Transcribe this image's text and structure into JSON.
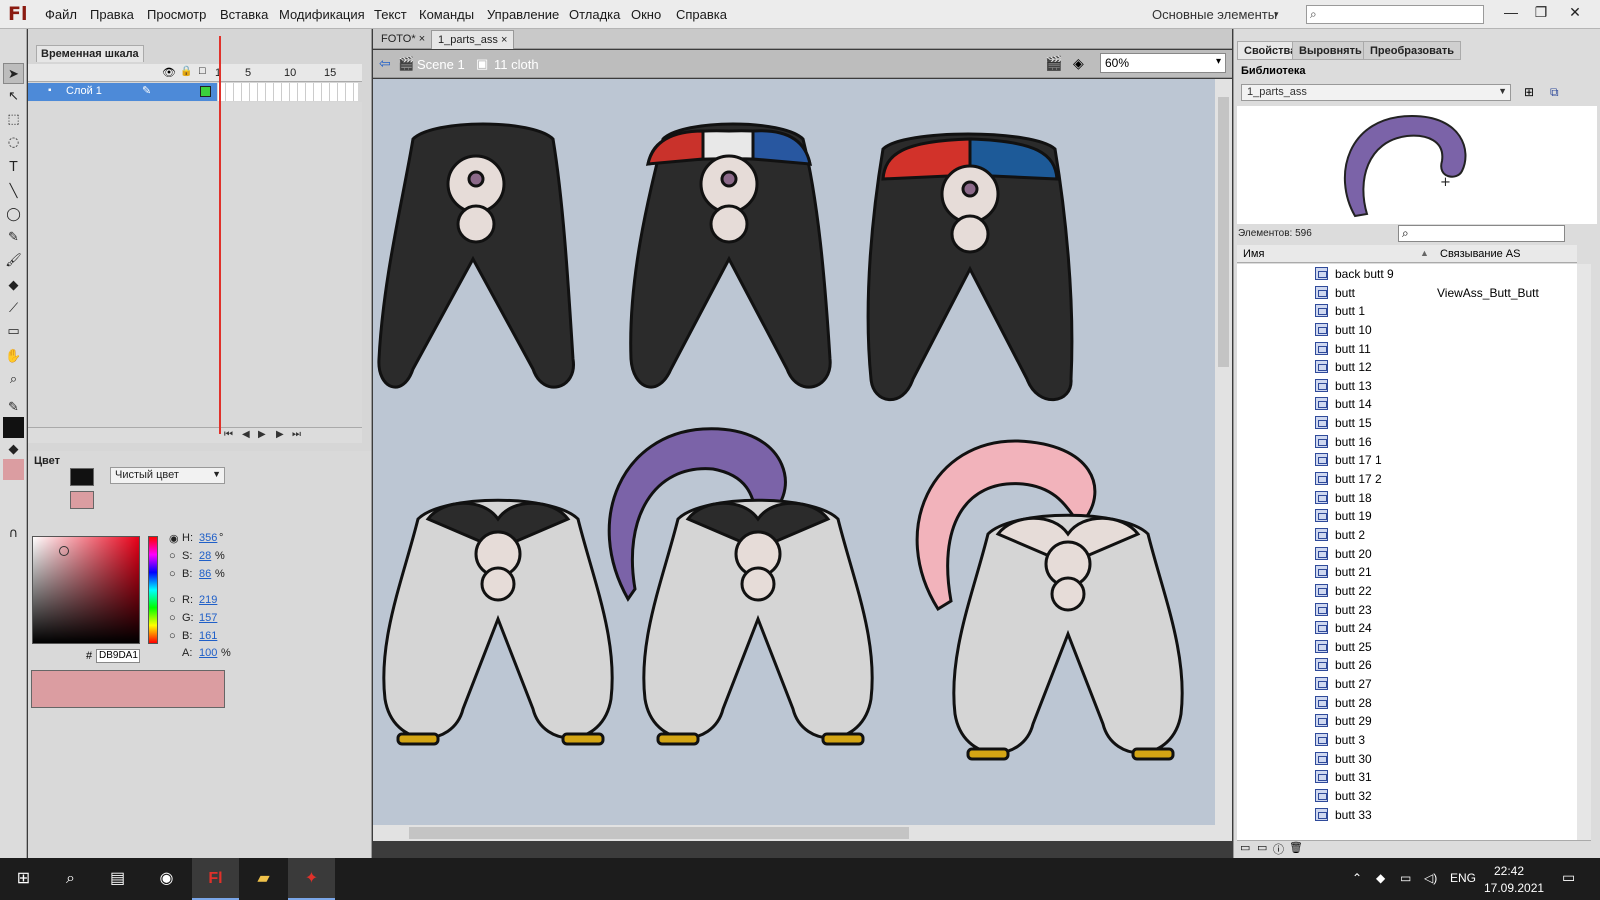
{
  "app": {
    "logo": "Fl",
    "menu": [
      "Файл",
      "Правка",
      "Просмотр",
      "Вставка",
      "Модификация",
      "Текст",
      "Команды",
      "Управление",
      "Отладка",
      "Окно",
      "Справка"
    ],
    "workspace": "Основные элементы"
  },
  "timeline": {
    "title": "Временная шкала",
    "layer_name": "Слой 1",
    "ruler": [
      "1",
      "5",
      "10",
      "15"
    ]
  },
  "color": {
    "title": "Цвет",
    "fill_type": "Чистый цвет",
    "h_label": "H:",
    "h": "356",
    "h_unit": "°",
    "s_label": "S:",
    "s": "28",
    "s_unit": "%",
    "b_label": "B:",
    "b": "86",
    "b_unit": "%",
    "r_label": "R:",
    "r": "219",
    "g_label": "G:",
    "g": "157",
    "bl_label": "B:",
    "bl": "161",
    "a_label": "A:",
    "a": "100",
    "a_unit": "%",
    "hex_symbol": "#",
    "hex": "DB9DA1",
    "color_value": "#db9da1"
  },
  "document": {
    "tabs": [
      "FOTO*",
      "1_parts_ass"
    ],
    "close_glyph": "×",
    "scene": "Scene 1",
    "symbol": "11 cloth",
    "zoom": "60%"
  },
  "right_panel": {
    "tabs": [
      "Свойства",
      "Выровнять",
      "Преобразовать"
    ],
    "library_title": "Библиотека",
    "library_file": "1_parts_ass",
    "item_count": "Элементов: 596",
    "col_name": "Имя",
    "col_link": "Связывание AS",
    "items": [
      {
        "name": "back butt 9",
        "link": ""
      },
      {
        "name": "butt",
        "link": "ViewAss_Butt_Butt"
      },
      {
        "name": "butt 1",
        "link": ""
      },
      {
        "name": "butt 10",
        "link": ""
      },
      {
        "name": "butt 11",
        "link": ""
      },
      {
        "name": "butt 12",
        "link": ""
      },
      {
        "name": "butt 13",
        "link": ""
      },
      {
        "name": "butt 14",
        "link": ""
      },
      {
        "name": "butt 15",
        "link": ""
      },
      {
        "name": "butt 16",
        "link": ""
      },
      {
        "name": "butt 17 1",
        "link": ""
      },
      {
        "name": "butt 17 2",
        "link": ""
      },
      {
        "name": "butt 18",
        "link": ""
      },
      {
        "name": "butt 19",
        "link": ""
      },
      {
        "name": "butt 2",
        "link": ""
      },
      {
        "name": "butt 20",
        "link": ""
      },
      {
        "name": "butt 21",
        "link": ""
      },
      {
        "name": "butt 22",
        "link": ""
      },
      {
        "name": "butt 23",
        "link": ""
      },
      {
        "name": "butt 24",
        "link": ""
      },
      {
        "name": "butt 25",
        "link": ""
      },
      {
        "name": "butt 26",
        "link": ""
      },
      {
        "name": "butt 27",
        "link": ""
      },
      {
        "name": "butt 28",
        "link": ""
      },
      {
        "name": "butt 29",
        "link": ""
      },
      {
        "name": "butt 3",
        "link": ""
      },
      {
        "name": "butt 30",
        "link": ""
      },
      {
        "name": "butt 31",
        "link": ""
      },
      {
        "name": "butt 32",
        "link": ""
      },
      {
        "name": "butt 33",
        "link": ""
      }
    ]
  },
  "taskbar": {
    "lang": "ENG",
    "time": "22:42",
    "date": "17.09.2021"
  },
  "icons": [
    "windows-start-icon",
    "search-icon",
    "task-view-icon",
    "firefox-icon",
    "flash-icon",
    "folder-icon",
    "app-icon"
  ],
  "accent_colors": {
    "layer_selected": "#4d8ad8",
    "playhead": "#e0312a",
    "stage_bg": "#bcc6d3",
    "tail_purple": "#7b63a8",
    "tail_pink": "#f2b3bb"
  }
}
